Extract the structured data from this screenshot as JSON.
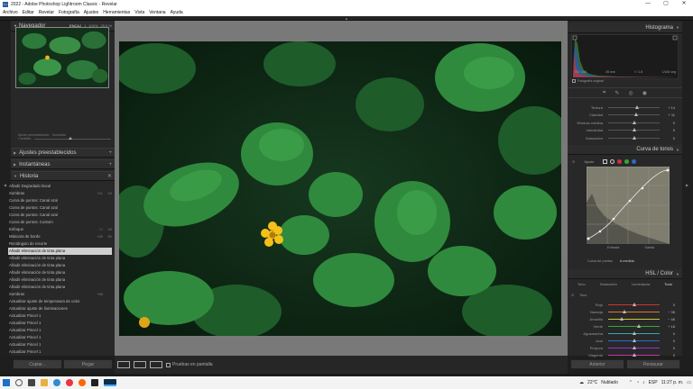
{
  "window": {
    "title": "2022 - Adobe Photoshop Lightroom Classic - Revelar",
    "app_icon": "Lr"
  },
  "menu": [
    "Archivo",
    "Editar",
    "Revelar",
    "Fotografía",
    "Ajustes",
    "Herramientas",
    "Vista",
    "Ventana",
    "Ayuda"
  ],
  "navigator": {
    "title": "Navegador",
    "zoom": [
      "ENCAJ",
      "1",
      "100%",
      "25.5 %"
    ]
  },
  "left_misc": {
    "presets_amount": "Ajuste preestablecido",
    "amount_label": "Cantidad",
    "ref": "Tonalidad"
  },
  "sections": {
    "presets": "Ajustes preestablecidos",
    "snapshots": "Instantáneas",
    "history": "Historia"
  },
  "history_items": [
    {
      "label": "Añadir Degradado lineal",
      "a": "",
      "b": ""
    },
    {
      "label": "Sombras",
      "a": "+61",
      "b": "63"
    },
    {
      "label": "Curva de puntos: Canal azul",
      "a": "",
      "b": ""
    },
    {
      "label": "Curva de puntos: Canal azul",
      "a": "",
      "b": ""
    },
    {
      "label": "Curva de puntos: Canal azul",
      "a": "",
      "b": ""
    },
    {
      "label": "Curva de puntos: Custom",
      "a": "",
      "b": ""
    },
    {
      "label": "Enfoque",
      "a": "+1",
      "b": "40"
    },
    {
      "label": "Máscara de borde",
      "a": "+80",
      "b": "80"
    },
    {
      "label": "Rectángulo de recorte",
      "a": "",
      "b": ""
    },
    {
      "label": "Añadir eliminación de tinta plana",
      "a": "",
      "b": ""
    },
    {
      "label": "Añadir eliminación de tinta plana",
      "a": "",
      "b": ""
    },
    {
      "label": "Añadir eliminación de tinta plana",
      "a": "",
      "b": ""
    },
    {
      "label": "Añadir eliminación de tinta plana",
      "a": "",
      "b": ""
    },
    {
      "label": "Añadir eliminación de tinta plana",
      "a": "",
      "b": ""
    },
    {
      "label": "Añadir eliminación de tinta plana",
      "a": "",
      "b": ""
    },
    {
      "label": "Sombras",
      "a": "+88",
      "b": ""
    },
    {
      "label": "Actualizar ajuste de temperatura de color",
      "a": "",
      "b": ""
    },
    {
      "label": "Actualizar ajuste de iluminaciones",
      "a": "",
      "b": ""
    },
    {
      "label": "Actualizar Pincel 1",
      "a": "",
      "b": ""
    },
    {
      "label": "Actualizar Pincel 1",
      "a": "",
      "b": ""
    },
    {
      "label": "Actualizar Pincel 1",
      "a": "",
      "b": ""
    },
    {
      "label": "Actualizar Pincel 1",
      "a": "",
      "b": ""
    },
    {
      "label": "Actualizar Pincel 1",
      "a": "",
      "b": ""
    },
    {
      "label": "Actualizar Pincel 1",
      "a": "",
      "b": ""
    }
  ],
  "selected_history_index": 9,
  "left_buttons": {
    "copy": "Copiar...",
    "paste": "Pegar"
  },
  "toolbar": {
    "soft_proof": "Pruebas en pantalla"
  },
  "right": {
    "histogram_title": "Histograma",
    "histo_info": [
      "ISO 400",
      "35 mm",
      "f / 1.8",
      "1/160 seg"
    ],
    "original_photo": "Fotografía original",
    "basic_sliders": [
      {
        "name": "Textura",
        "value": "+ 14",
        "pos": 0.57
      },
      {
        "name": "Claridad",
        "value": "+ 11",
        "pos": 0.55
      },
      {
        "name": "Eliminar neblina",
        "value": "0",
        "pos": 0.5
      },
      {
        "name": "Intensidad",
        "value": "0",
        "pos": 0.5
      },
      {
        "name": "Saturación",
        "value": "0",
        "pos": 0.5
      }
    ],
    "tone_curve_title": "Curva de tonos",
    "curve_adjust": "Ajuste",
    "curve_labels": {
      "entrada": "Entrada",
      "salida": "Salida",
      "point_curve": "Curva de puntos",
      "point_value": "A medida"
    },
    "hsl_title": "HSL / Color",
    "hsl_tabs": [
      "Tono",
      "Saturación",
      "Luminancia",
      "Todo"
    ],
    "hsl_selected_tab": "Todo",
    "hsl_group": "Tono",
    "hsl_sliders": [
      {
        "name": "Rojo",
        "value": "0",
        "pos": 0.5,
        "color": "#c33"
      },
      {
        "name": "Naranja",
        "value": "− 35",
        "pos": 0.32,
        "color": "#d73"
      },
      {
        "name": "Amarillo",
        "value": "− 46",
        "pos": 0.27,
        "color": "#cc3"
      },
      {
        "name": "Verde",
        "value": "+ 18",
        "pos": 0.59,
        "color": "#3a3"
      },
      {
        "name": "Aguamarina",
        "value": "0",
        "pos": 0.5,
        "color": "#3aa"
      },
      {
        "name": "Azul",
        "value": "0",
        "pos": 0.5,
        "color": "#36c"
      },
      {
        "name": "Púrpura",
        "value": "0",
        "pos": 0.5,
        "color": "#93c"
      },
      {
        "name": "Magenta",
        "value": "0",
        "pos": 0.5,
        "color": "#c3a"
      }
    ],
    "prev_button": "Anterior",
    "reset_button": "Restaurar"
  },
  "taskbar": {
    "weather_temp": "22°C",
    "weather_text": "Nublado",
    "lang": "ESP",
    "time": "11:27 p. m."
  },
  "colors": {
    "panel": "#282828",
    "selected_row": "#cfcfcf",
    "accent": "#1a73c9"
  }
}
